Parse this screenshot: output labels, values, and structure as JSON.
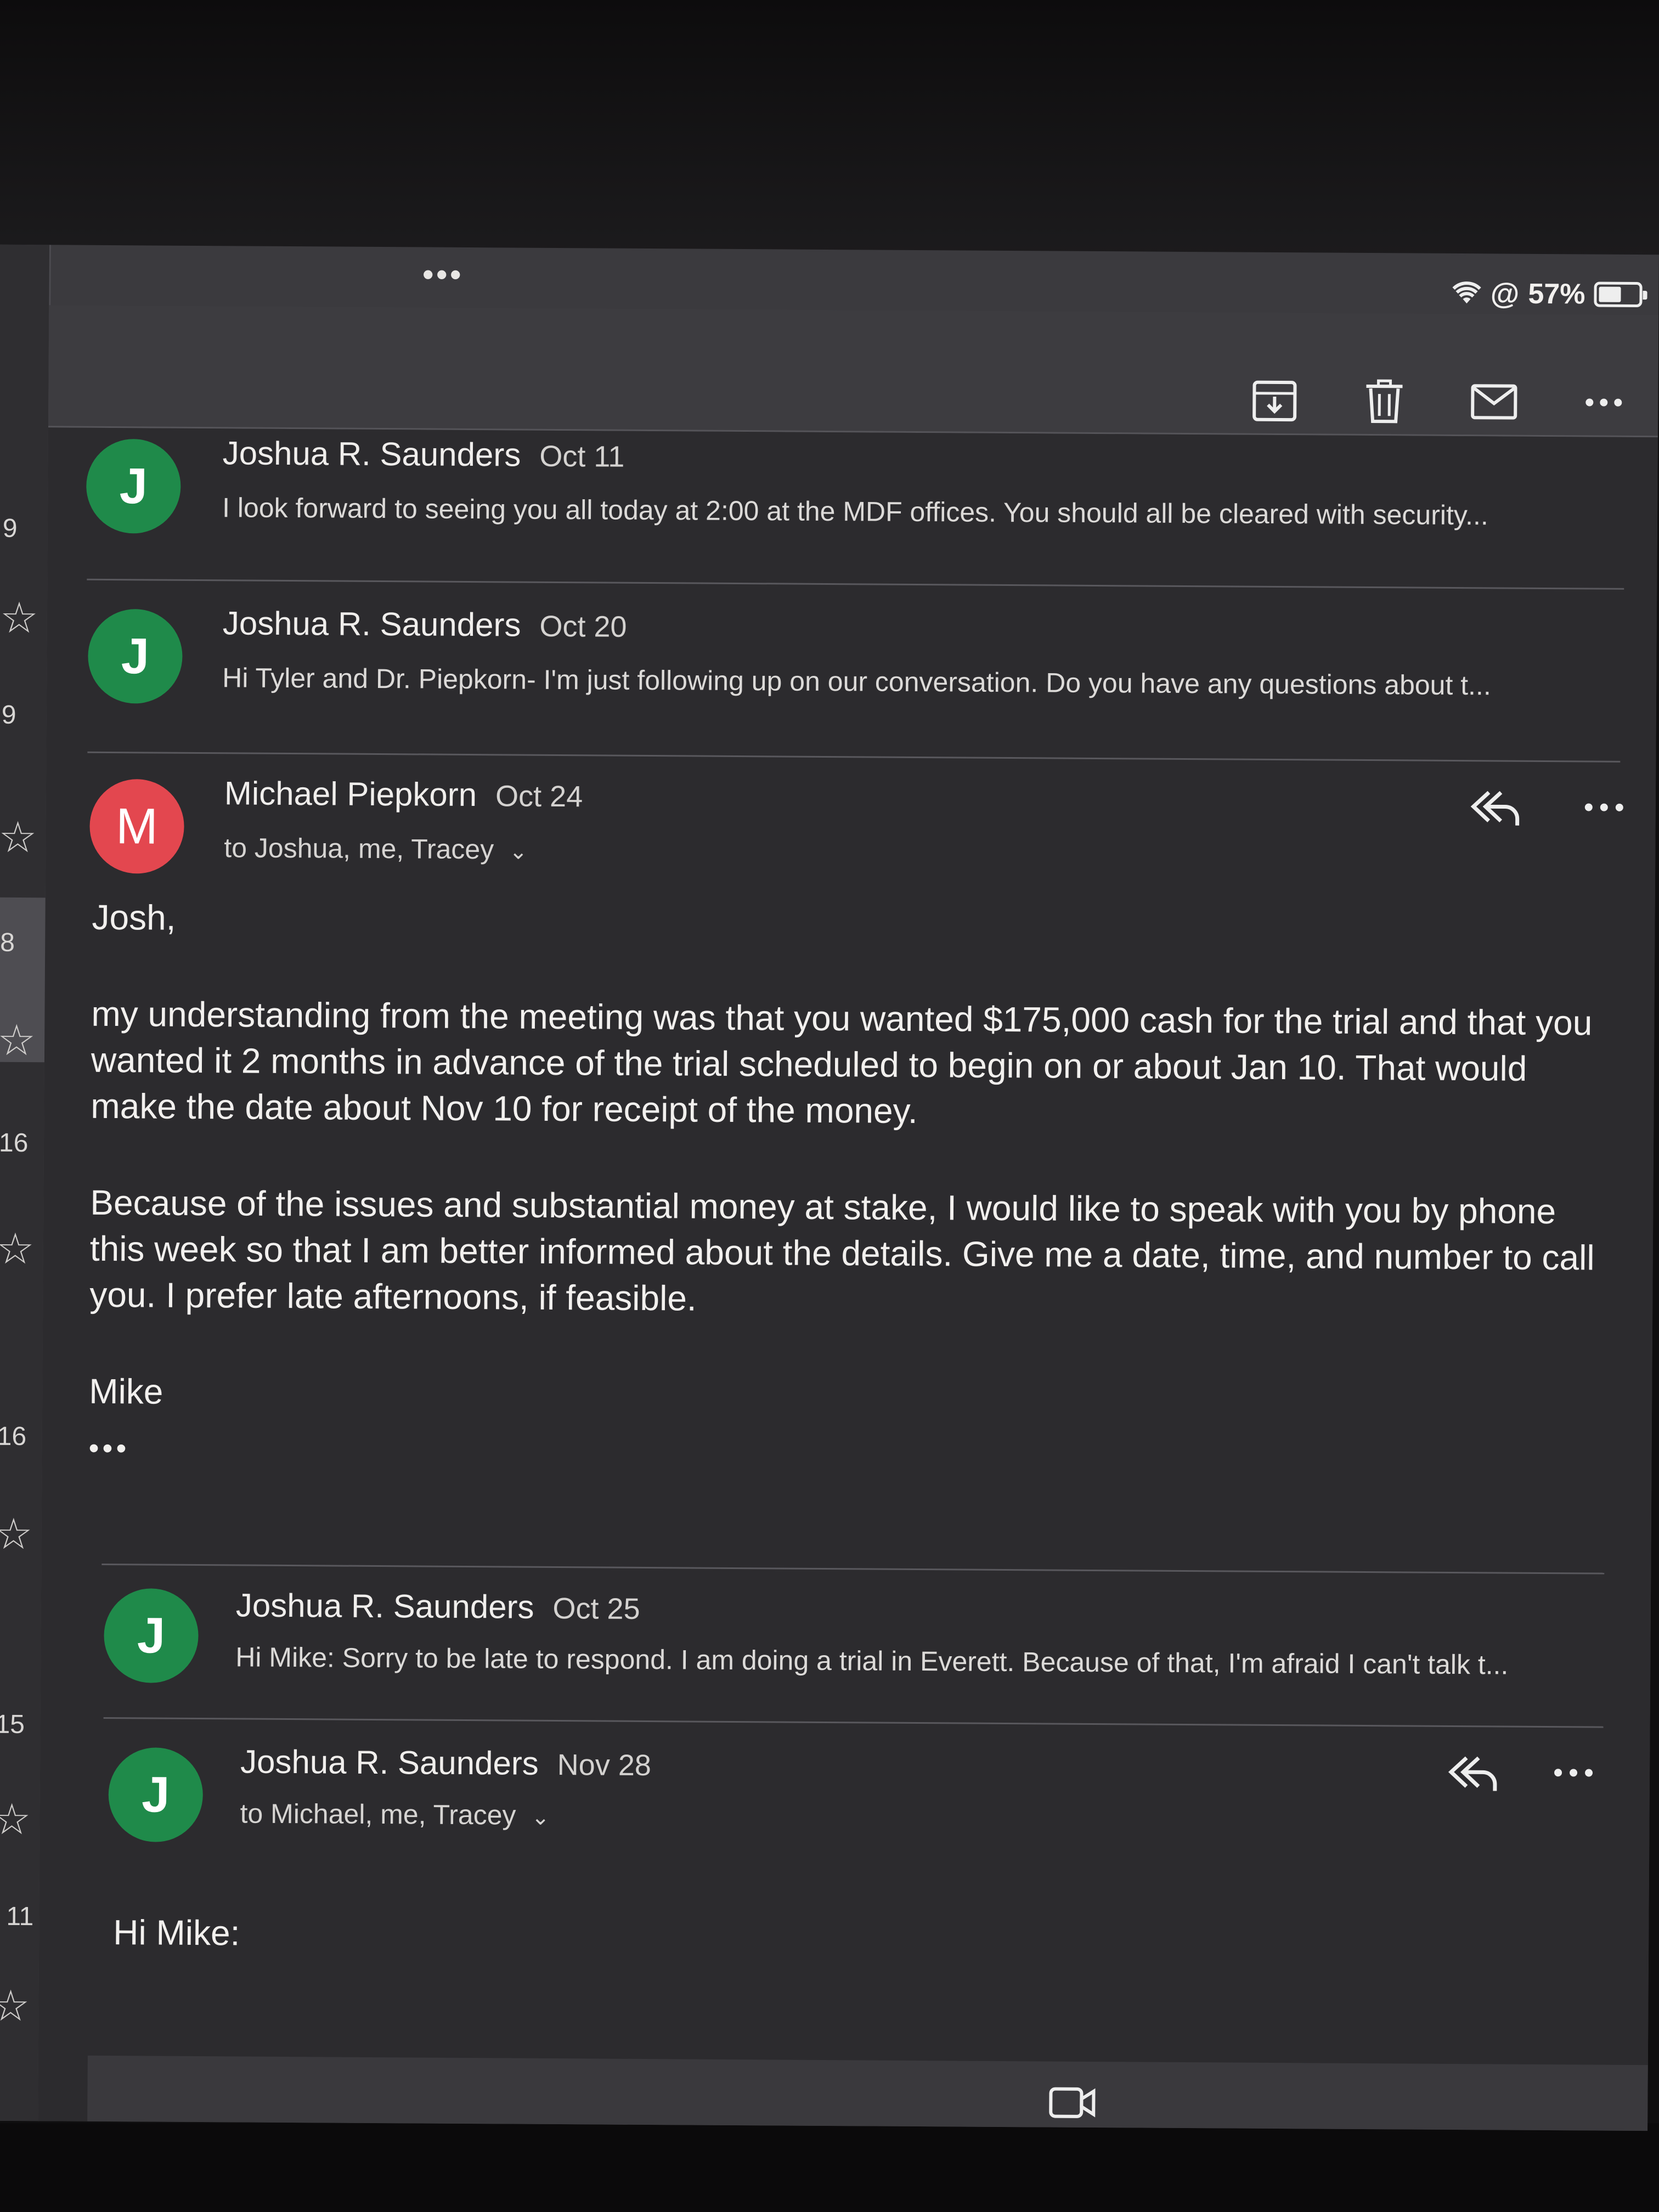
{
  "status_bar": {
    "battery_text": "57%",
    "battery_level": 0.57
  },
  "sidebar": {
    "counts": [
      "9",
      "9",
      "8",
      "16",
      "16",
      "15",
      "11"
    ]
  },
  "toolbar": {
    "actions": [
      "archive-icon",
      "trash-icon",
      "mark-unread-icon",
      "more-icon"
    ]
  },
  "thread": {
    "messages": [
      {
        "avatar_letter": "J",
        "sender": "Joshua R. Saunders",
        "date": "Oct 11",
        "snippet": "I look forward to seeing you all today at 2:00 at the MDF offices. You should all be cleared with security..."
      },
      {
        "avatar_letter": "J",
        "sender": "Joshua R. Saunders",
        "date": "Oct 20",
        "snippet": "Hi Tyler and Dr. Piepkorn- I'm just following up on our conversation. Do you have any questions about t..."
      },
      {
        "avatar_letter": "M",
        "sender": "Michael Piepkorn",
        "date": "Oct 24",
        "recipients": "to Joshua, me, Tracey",
        "body": {
          "greeting": "Josh,",
          "paragraph1": "my understanding from the meeting was that you wanted $175,000 cash for the trial and that you wanted it 2 months in advance of the trial scheduled to begin on or about Jan 10. That would make the date about Nov 10 for receipt of the money.",
          "paragraph2": "Because of the issues and substantial money at stake, I would like to speak with you by phone this week so that I am better informed about the details. Give me a date, time, and number to call you. I prefer late afternoons, if feasible.",
          "signature": "Mike",
          "quoted_marker": "•••"
        }
      },
      {
        "avatar_letter": "J",
        "sender": "Joshua R. Saunders",
        "date": "Oct 25",
        "snippet": "Hi Mike: Sorry to be late to respond. I am doing a trial in Everett. Because of that, I'm afraid I can't talk t..."
      },
      {
        "avatar_letter": "J",
        "sender": "Joshua R. Saunders",
        "date": "Nov 28",
        "recipients": "to Michael, me, Tracey",
        "body": {
          "greeting": "Hi Mike:"
        }
      }
    ]
  },
  "colors": {
    "avatar_green": "#1f8a4a",
    "avatar_red": "#e3474f",
    "background": "#2c2b2e"
  }
}
